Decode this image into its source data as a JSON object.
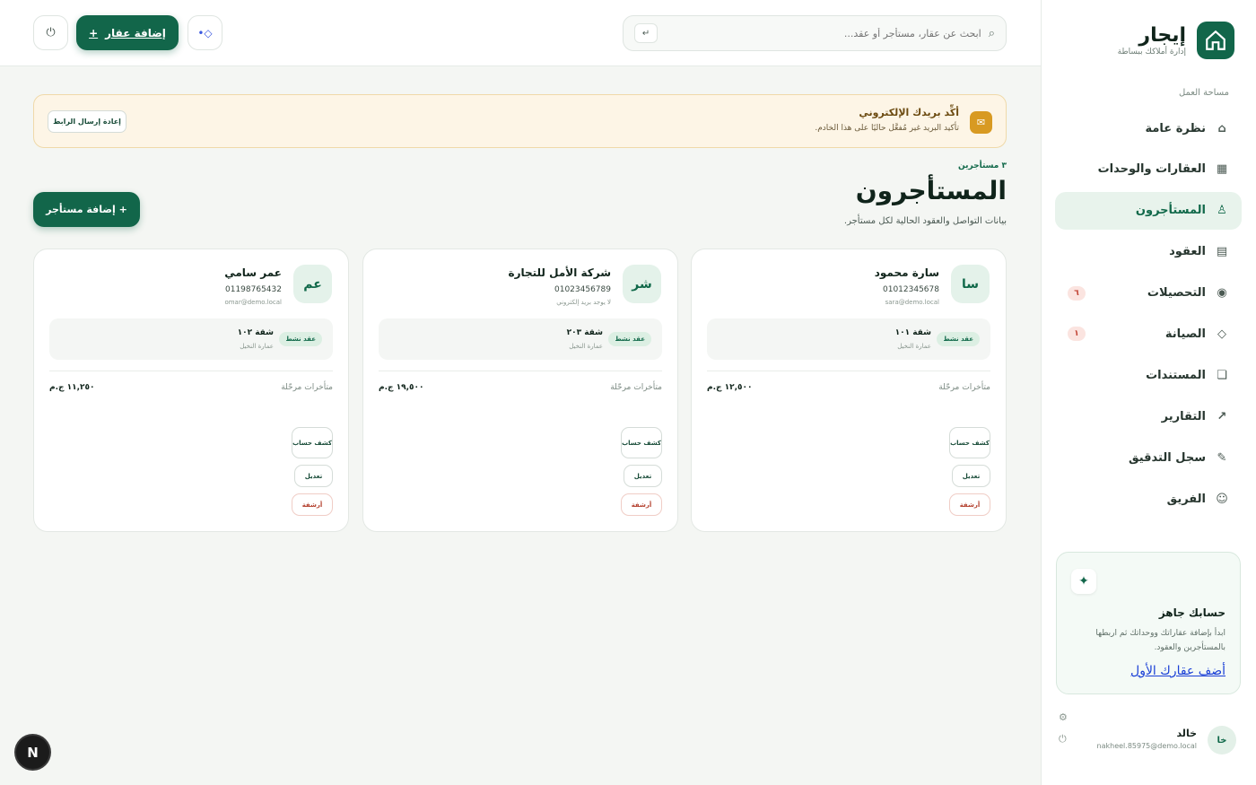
{
  "brand": {
    "name": "إيجار",
    "tagline": "إدارة أملاكك ببساطة"
  },
  "sidebar": {
    "section_label": "مساحة العمل",
    "items": [
      {
        "label": "نظرة عامة",
        "icon": "home-icon",
        "glyph": "⌂",
        "badge": ""
      },
      {
        "label": "العقارات والوحدات",
        "icon": "building-icon",
        "glyph": "▦",
        "badge": ""
      },
      {
        "label": "المستأجرون",
        "icon": "person-icon",
        "glyph": "♙",
        "badge": ""
      },
      {
        "label": "العقود",
        "icon": "contract-icon",
        "glyph": "▤",
        "badge": ""
      },
      {
        "label": "التحصيلات",
        "icon": "payments-icon",
        "glyph": "◉",
        "badge": "٦"
      },
      {
        "label": "الصيانة",
        "icon": "wrench-icon",
        "glyph": "◇",
        "badge": "١"
      },
      {
        "label": "المستندات",
        "icon": "document-icon",
        "glyph": "❏",
        "badge": ""
      },
      {
        "label": "التقارير",
        "icon": "chart-icon",
        "glyph": "↗",
        "badge": ""
      },
      {
        "label": "سجل التدقيق",
        "icon": "audit-icon",
        "glyph": "✎",
        "badge": ""
      },
      {
        "label": "الفريق",
        "icon": "team-icon",
        "glyph": "☺",
        "badge": ""
      }
    ],
    "active_index": 2,
    "ready_card": {
      "title": "حسابك جاهز",
      "description": "ابدأ بإضافة عقاراتك ووحداتك ثم اربطها بالمستأجرين والعقود.",
      "link": "أضف عقارك الأول"
    },
    "user": {
      "initials": "خا",
      "name": "خالد",
      "email": "nakheel.85975@demo.local"
    }
  },
  "topbar": {
    "search_placeholder": "ابحث عن عقار، مستأجر أو عقد...",
    "search_kbd": "↵",
    "add_property_label": "إضافة عقار"
  },
  "banner": {
    "title": "أكِّد بريدك الإلكتروني",
    "subtitle": "تأكيد البريد غير مُفعَّل حاليًا على هذا الخادم.",
    "action": "إعادة إرسال الرابط"
  },
  "page": {
    "count": "٣ مستأجرين",
    "title": "المستأجرون",
    "subtitle": "بيانات التواصل والعقود الحالية لكل مستأجر.",
    "add_label": "+  إضافة مستأجر"
  },
  "tenants": [
    {
      "initials": "سا",
      "name": "سارة محمود",
      "phone": "01012345678",
      "email": "sara@demo.local",
      "contract_badge": "عقد نشط",
      "unit": "شقة ١٠١",
      "building": "عمارة النخيل",
      "due_label": "متأخرات مرحّلة",
      "due_value": "١٢,٥٠٠ ج.م",
      "btn_statement": "كشف حساب",
      "btn_edit": "تعديل",
      "btn_archive": "أرشفة"
    },
    {
      "initials": "شر",
      "name": "شركة الأمل للتجارة",
      "phone": "01023456789",
      "email": "لا يوجد بريد إلكتروني",
      "contract_badge": "عقد نشط",
      "unit": "شقة ٢٠٣",
      "building": "عمارة النخيل",
      "due_label": "متأخرات مرحّلة",
      "due_value": "١٩,٥٠٠ ج.م",
      "btn_statement": "كشف حساب",
      "btn_edit": "تعديل",
      "btn_archive": "أرشفة"
    },
    {
      "initials": "عم",
      "name": "عمر سامي",
      "phone": "01198765432",
      "email": "omar@demo.local",
      "contract_badge": "عقد نشط",
      "unit": "شقة ١٠٢",
      "building": "عمارة النخيل",
      "due_label": "متأخرات مرحّلة",
      "due_value": "١١,٢٥٠ ج.م",
      "btn_statement": "كشف حساب",
      "btn_edit": "تعديل",
      "btn_archive": "أرشفة"
    }
  ],
  "dev_badge": "N",
  "colors": {
    "brand": "#12664a",
    "warning": "#d89a22",
    "danger": "#b4412f"
  }
}
